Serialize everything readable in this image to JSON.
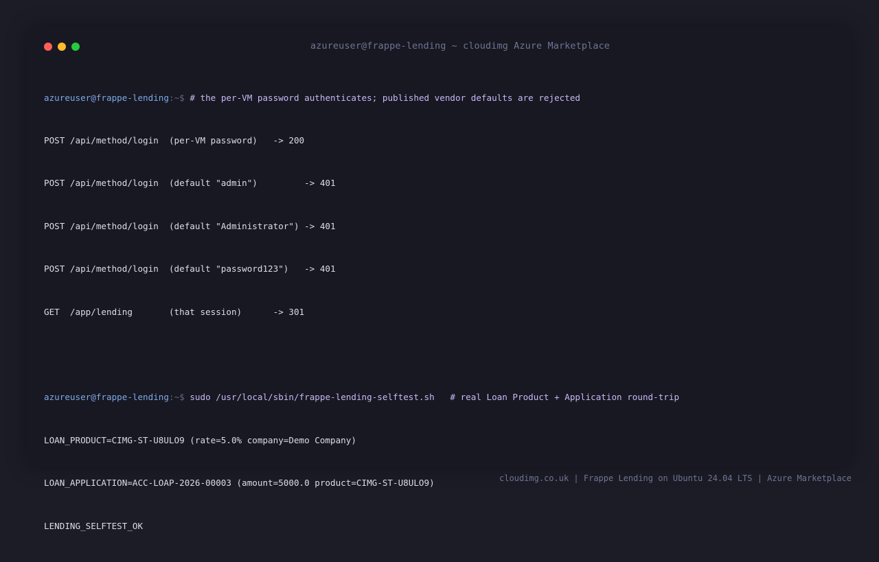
{
  "window": {
    "title": "azureuser@frappe-lending ~ cloudimg Azure Marketplace"
  },
  "terminal": {
    "block1": {
      "prompt_user": "azureuser@frappe-lending",
      "prompt_path": ":~$ ",
      "command": "# the per-VM password authenticates; published vendor defaults are rejected",
      "output": [
        "POST /api/method/login  (per-VM password)   -> 200",
        "POST /api/method/login  (default \"admin\")         -> 401",
        "POST /api/method/login  (default \"Administrator\") -> 401",
        "POST /api/method/login  (default \"password123\")   -> 401",
        "GET  /app/lending       (that session)      -> 301"
      ]
    },
    "block2": {
      "prompt_user": "azureuser@frappe-lending",
      "prompt_path": ":~$ ",
      "command": "sudo /usr/local/sbin/frappe-lending-selftest.sh   # real Loan Product + Application round-trip",
      "output": [
        "LOAN_PRODUCT=CIMG-ST-U8ULO9 (rate=5.0% company=Demo Company)",
        "LOAN_APPLICATION=ACC-LOAP-2026-00003 (amount=5000.0 product=CIMG-ST-U8ULO9)",
        "LENDING_SELFTEST_OK"
      ]
    }
  },
  "footer": {
    "text": "cloudimg.co.uk | Frappe Lending on Ubuntu 24.04 LTS | Azure Marketplace"
  },
  "colors": {
    "background": "#1b1c26",
    "window": "#171821",
    "prompt_user": "#7fa8e8",
    "command": "#c9b8f5",
    "output": "#dcdde6",
    "muted": "#6f7592"
  }
}
